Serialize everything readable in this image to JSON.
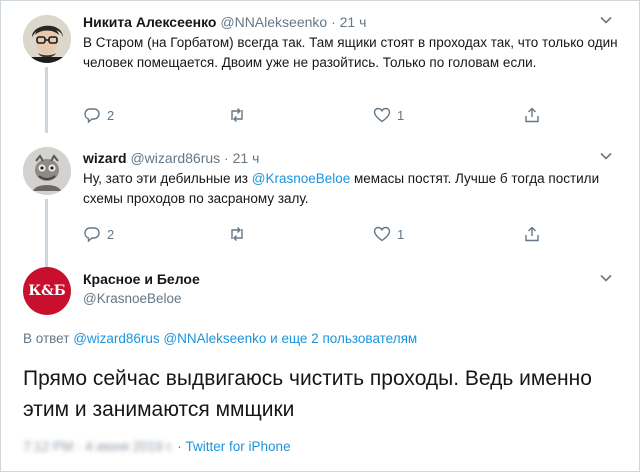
{
  "tweets": [
    {
      "name": "Никита Алексеенко",
      "handle": "@NNAlekseenko",
      "separator": "·",
      "time": "21 ч",
      "text": "В Старом (на Горбатом) всегда так. Там ящики стоят в проходах так, что только один человек помещается. Двоим уже не разойтись. Только по головам если.",
      "replies": "2",
      "likes": "1"
    },
    {
      "name": "wizard",
      "handle": "@wizard86rus",
      "separator": "·",
      "time": "21 ч",
      "text_before": "Ну, зато эти дебильные из ",
      "mention": "@KrasnoeBeloe",
      "text_after": " мемасы постят. Лучше б тогда постили схемы проходов по засраному залу.",
      "replies": "2",
      "likes": "1"
    }
  ],
  "main": {
    "avatar_text": "К&Б",
    "name": "Красное и Белое",
    "handle": "@KrasnoeBeloe",
    "reply_prefix": "В ответ",
    "reply_users": "@wizard86rus @NNAlekseenko",
    "reply_suffix": " и еще 2 пользователям",
    "text": "Прямо сейчас выдвигаюсь чистить проходы. Ведь именно этим и занимаются ммщики",
    "meta_blurred": "7:12 PM · 4 июня 2019 г.",
    "meta_separator": " · ",
    "source": "Twitter for iPhone"
  },
  "colors": {
    "accent": "#1b95e0",
    "muted": "#657786",
    "brand_red": "#c8102e"
  },
  "icons": [
    "reply-icon",
    "retweet-icon",
    "like-icon",
    "share-icon",
    "chevron-down-icon"
  ]
}
